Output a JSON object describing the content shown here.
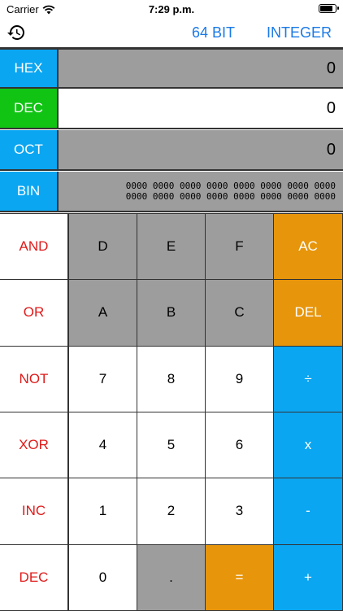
{
  "status_bar": {
    "carrier": "Carrier",
    "time": "7:29 p.m.",
    "battery_level": 0.9
  },
  "toolbar": {
    "history_icon": "history-icon",
    "bit_width": "64 BIT",
    "mode": "INTEGER"
  },
  "display": {
    "hex": {
      "label": "HEX",
      "value": "0"
    },
    "dec": {
      "label": "DEC",
      "value": "0"
    },
    "oct": {
      "label": "OCT",
      "value": "0"
    },
    "bin": {
      "label": "BIN",
      "line1": "0000 0000 0000 0000 0000 0000 0000 0000",
      "line2": "0000 0000 0000 0000 0000 0000 0000 0000"
    }
  },
  "keypad": {
    "row1": [
      "AND",
      "D",
      "E",
      "F",
      "AC"
    ],
    "row2": [
      "OR",
      "A",
      "B",
      "C",
      "DEL"
    ],
    "row3": [
      "NOT",
      "7",
      "8",
      "9",
      "÷"
    ],
    "row4": [
      "XOR",
      "4",
      "5",
      "6",
      "x"
    ],
    "row5": [
      "INC",
      "1",
      "2",
      "3",
      "-"
    ],
    "row6": [
      "DEC",
      "0",
      ".",
      "=",
      "+"
    ]
  },
  "colors": {
    "accent_blue": "#0aa6f2",
    "active_green": "#11c414",
    "disabled_gray": "#9d9d9d",
    "orange": "#e7950b",
    "logic_red": "#e01a1a",
    "link_blue": "#1a7ae6"
  }
}
